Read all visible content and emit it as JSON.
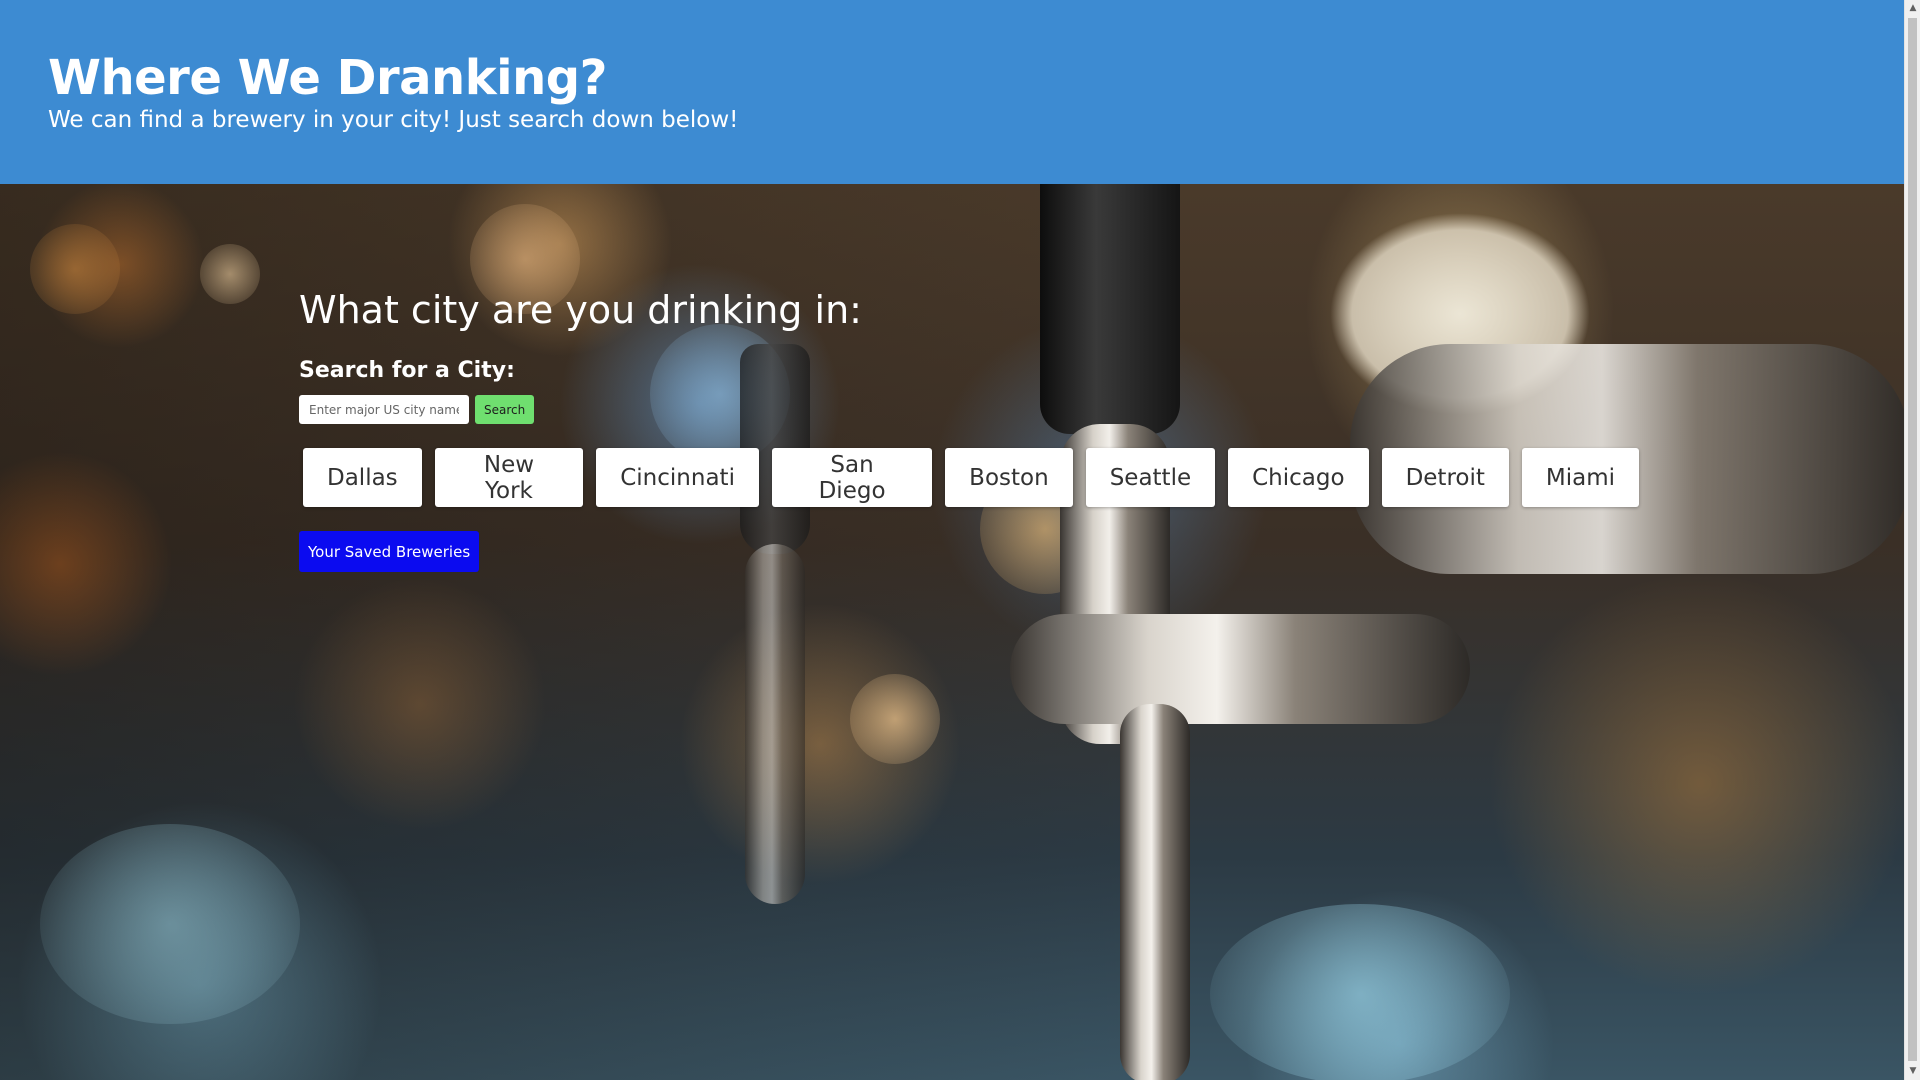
{
  "header": {
    "title": "Where We Dranking?",
    "subtitle": "We can find a brewery in your city! Just search down below!",
    "background_color": "#3d8bd2"
  },
  "main": {
    "question": "What city are you drinking in:",
    "search_title": "Search for a City:",
    "search_input": {
      "placeholder": "Enter major US city name",
      "value": ""
    },
    "search_button_label": "Search",
    "cities": [
      {
        "label": "Dallas"
      },
      {
        "label": "New York"
      },
      {
        "label": "Cincinnati"
      },
      {
        "label": "San Diego"
      },
      {
        "label": "Boston"
      },
      {
        "label": "Seattle"
      },
      {
        "label": "Chicago"
      },
      {
        "label": "Detroit"
      },
      {
        "label": "Miami"
      }
    ],
    "saved_button_label": "Your Saved Breweries",
    "colors": {
      "search_button": "#6fdf6f",
      "saved_button": "#0b0bf0"
    }
  },
  "background": {
    "description_icon": "beer-tap-photo"
  }
}
